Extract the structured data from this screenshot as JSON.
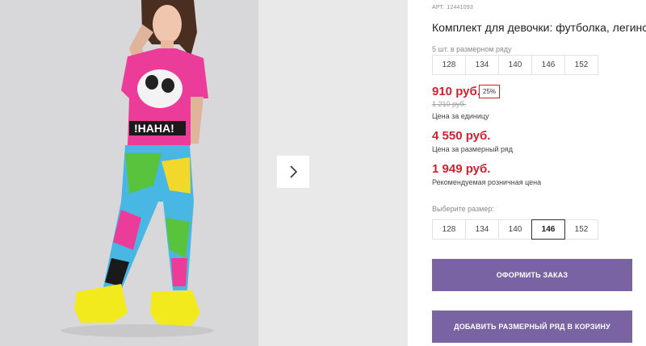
{
  "product": {
    "article_label": "АРТ.",
    "article_number": "12441093",
    "title": "Комплект для девочки: футболка, легинсы",
    "row_caption": "5 шт. в размерном ряду",
    "row_sizes": [
      "128",
      "134",
      "140",
      "146",
      "152"
    ],
    "price": "910 руб.",
    "discount": "25%",
    "old_price": "1 210 руб.",
    "unit_caption": "Цена за единицу",
    "row_price": "4 550 руб.",
    "row_price_caption": "Цена за размерный ряд",
    "rrp": "1 949 руб.",
    "rrp_caption": "Рекомендуемая розничная цена",
    "choose_size_label": "Выберите размер:",
    "select_sizes": [
      "128",
      "134",
      "140",
      "146",
      "152"
    ],
    "selected_size": "146",
    "order_button": "ОФОРМИТЬ ЗАКАЗ",
    "cart_button": "ДОБАВИТЬ РАЗМЕРНЫЙ РЯД В КОРЗИНУ"
  },
  "gallery": {
    "next_icon": "chevron-right-icon"
  },
  "colors": {
    "accent": "#7a63a3",
    "price": "#d1222f",
    "shirt": "#ec3c9a",
    "shoes": "#f2ea1c"
  }
}
